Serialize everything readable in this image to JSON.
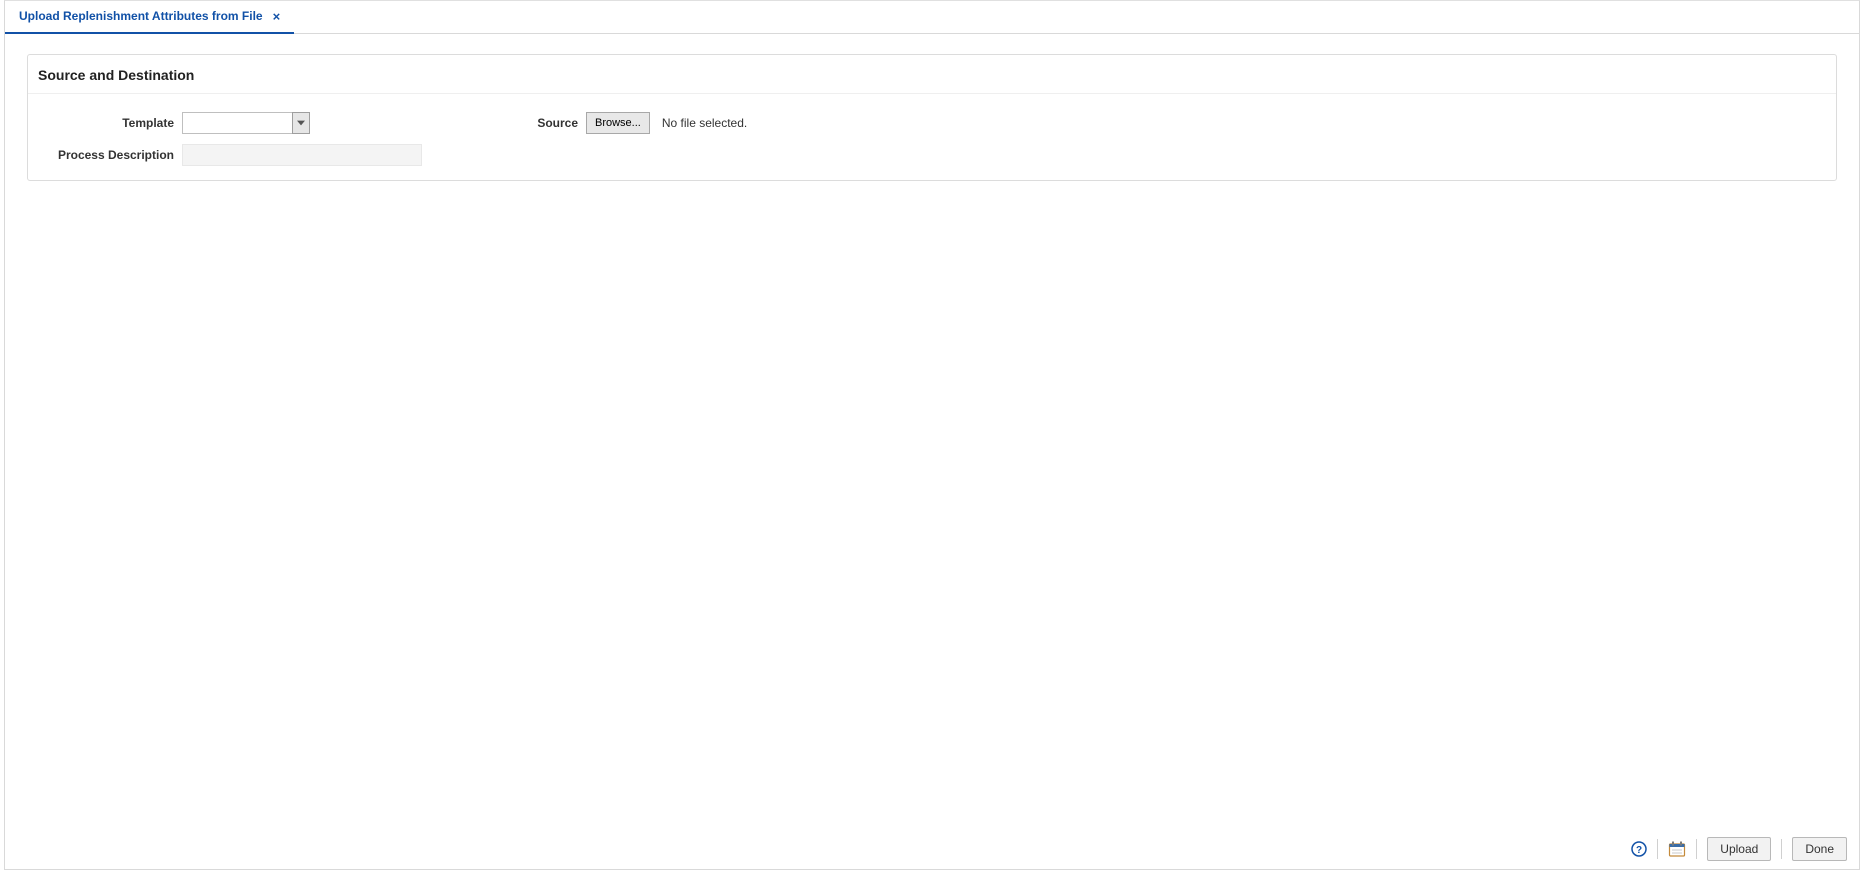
{
  "tab": {
    "label": "Upload Replenishment Attributes from File"
  },
  "panel": {
    "title": "Source and Destination",
    "template_label": "Template",
    "template_value": "",
    "process_desc_label": "Process Description",
    "process_desc_value": "",
    "source_label": "Source",
    "browse_label": "Browse...",
    "file_status": "No file selected."
  },
  "footer": {
    "upload_label": "Upload",
    "done_label": "Done"
  }
}
